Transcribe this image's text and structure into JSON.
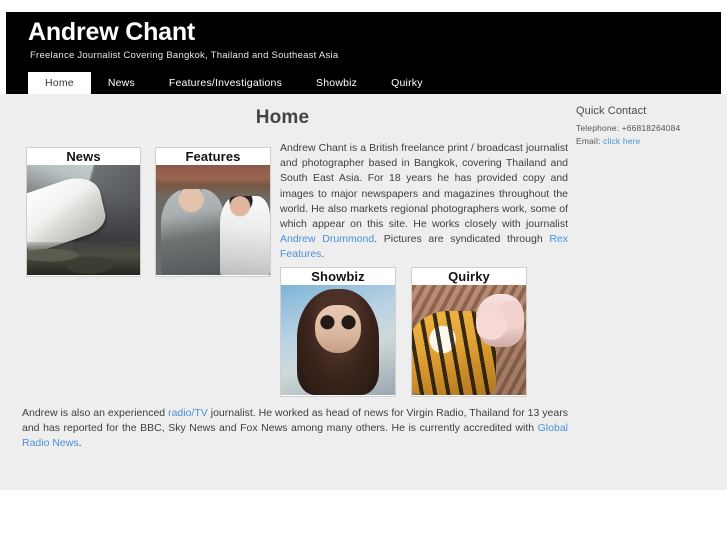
{
  "site": {
    "title": "Andrew Chant",
    "tagline": "Freelance Journalist Covering Bangkok, Thailand and Southeast Asia"
  },
  "nav": {
    "items": [
      {
        "label": "Home",
        "active": true
      },
      {
        "label": "News",
        "active": false
      },
      {
        "label": "Features/Investigations",
        "active": false
      },
      {
        "label": "Showbiz",
        "active": false
      },
      {
        "label": "Quirky",
        "active": false
      }
    ]
  },
  "main": {
    "page_title": "Home",
    "tiles": [
      {
        "caption": "News",
        "image_alt": "wrecked speedboat against damaged building"
      },
      {
        "caption": "Features",
        "image_alt": "elderly man in cap talking with young woman at a shopfront"
      },
      {
        "caption": "Showbiz",
        "image_alt": "long dark haired man wearing round sunglasses"
      },
      {
        "caption": "Quirky",
        "image_alt": "tiger lying beside piglets"
      }
    ],
    "intro_paragraph": {
      "part1": "Andrew Chant is a British freelance print / broadcast journalist and photographer based in Bangkok, covering Thailand and South East Asia.  For 18 years he has provided copy and images to major newspapers and magazines throughout the world. He also markets regional photographers work, some of which appear on this site. He works closely with journalist ",
      "link1": "Andrew Drummond",
      "part2": ". Pictures are syndicated through ",
      "link2": "Rex Features",
      "part3": "."
    },
    "outro_paragraph": {
      "part1": "Andrew is also an experienced ",
      "link1": "radio/TV",
      "part2": " journalist. He worked as head of news for Virgin Radio, Thailand for 13 years and has reported for the BBC, Sky News and Fox News among many others. He is currently accredited with ",
      "link2": "Global Radio News",
      "part3": "."
    }
  },
  "sidebar": {
    "title": "Quick Contact",
    "telephone_label": "Telephone: +66818264084",
    "email_label": "Email: ",
    "email_link": "click here"
  },
  "colors": {
    "header_bg": "#000000",
    "body_bg": "#eeeeee",
    "link": "#4a90d9",
    "text": "#3f3f3f"
  }
}
